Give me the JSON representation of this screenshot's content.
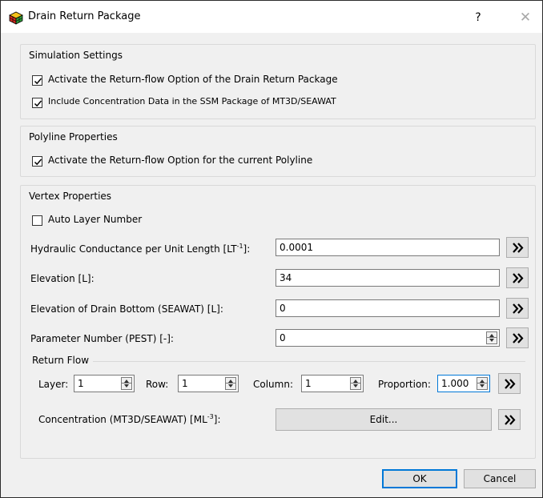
{
  "window": {
    "title": "Drain Return Package",
    "help": "?",
    "close": "✕"
  },
  "simulation": {
    "title": "Simulation Settings",
    "activate_label": "Activate the Return-flow Option of the Drain Return Package",
    "activate_checked": true,
    "include_label": "Include Concentration Data in the SSM Package of MT3D/SEAWAT",
    "include_checked": true
  },
  "polyline": {
    "title": "Polyline Properties",
    "activate_label": "Activate the Return-flow Option for the current Polyline",
    "activate_checked": true
  },
  "vertex": {
    "title": "Vertex Properties",
    "auto_layer_label": "Auto Layer Number",
    "auto_layer_checked": false,
    "conductance_label_pre": "Hydraulic Conductance per Unit Length [LT",
    "conductance_label_sup": "-1",
    "conductance_label_post": "]:",
    "conductance_value": "0.0001",
    "elevation_label": "Elevation [L]:",
    "elevation_value": "34",
    "bottom_label": "Elevation of Drain Bottom (SEAWAT) [L]:",
    "bottom_value": "0",
    "param_label": "Parameter Number (PEST) [-]:",
    "param_value": "0"
  },
  "return_flow": {
    "title": "Return Flow",
    "layer_label": "Layer:",
    "layer_value": "1",
    "row_label": "Row:",
    "row_value": "1",
    "column_label": "Column:",
    "column_value": "1",
    "proportion_label": "Proportion:",
    "proportion_value": "1.000",
    "concentration_label_pre": "Concentration (MT3D/SEAWAT) [ML",
    "concentration_label_sup": "-3",
    "concentration_label_post": "]:",
    "edit_label": "Edit..."
  },
  "buttons": {
    "ok": "OK",
    "cancel": "Cancel"
  },
  "icons": {
    "app": "app-grid-icon",
    "expand": "double-chevron-right-icon",
    "check": "checkmark-icon"
  },
  "colors": {
    "accent": "#0078d7",
    "icon_red": "#d42b1e",
    "icon_green": "#2e9a3a",
    "icon_yellow": "#f3c21b"
  }
}
